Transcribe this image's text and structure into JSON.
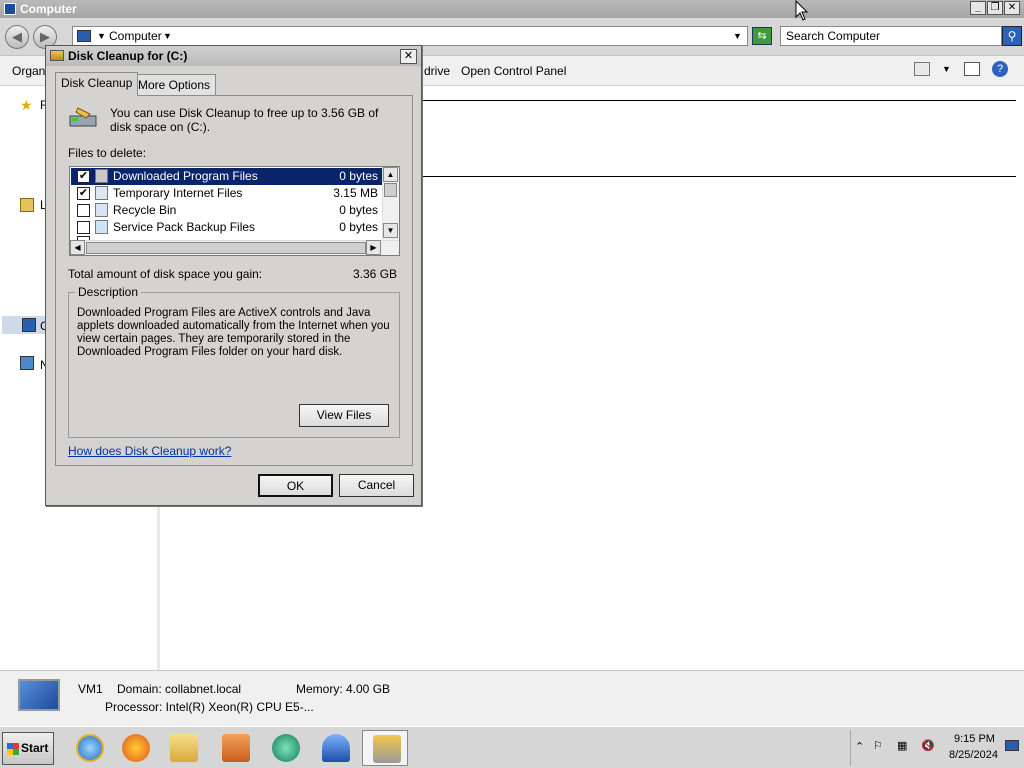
{
  "window": {
    "title": "Computer"
  },
  "address": {
    "crumb": "Computer",
    "search_placeholder": "Search Computer"
  },
  "commandbar": {
    "organize": "Organi",
    "drive": "drive",
    "control_panel": "Open Control Panel"
  },
  "nav_letters": {
    "favorites": "F",
    "libraries": "L",
    "computer": "C",
    "network": "N"
  },
  "details": {
    "name": "VM1",
    "domain": "Domain: collabnet.local",
    "memory": "Memory: 4.00 GB",
    "processor": "Processor: Intel(R) Xeon(R) CPU E5-..."
  },
  "taskbar": {
    "start": "Start",
    "time": "9:15 PM",
    "date": "8/25/2024"
  },
  "dialog": {
    "title": "Disk Cleanup for  (C:)",
    "tabs": [
      "Disk Cleanup",
      "More Options"
    ],
    "intro": "You can use Disk Cleanup to free up to 3.56 GB of disk space on  (C:).",
    "files_label": "Files to delete:",
    "files": [
      {
        "name": "Downloaded Program Files",
        "size": "0 bytes",
        "checked": true,
        "selected": true
      },
      {
        "name": "Temporary Internet Files",
        "size": "3.15 MB",
        "checked": true,
        "selected": false
      },
      {
        "name": "Recycle Bin",
        "size": "0 bytes",
        "checked": false,
        "selected": false
      },
      {
        "name": "Service Pack Backup Files",
        "size": "0 bytes",
        "checked": false,
        "selected": false
      }
    ],
    "total_label": "Total amount of disk space you gain:",
    "total_value": "3.36 GB",
    "description_legend": "Description",
    "description": "Downloaded Program Files are ActiveX controls and Java applets downloaded automatically from the Internet when you view certain pages. They are temporarily stored in the Downloaded Program Files folder on your hard disk.",
    "view_files": "View Files",
    "help_link": "How does Disk Cleanup work?",
    "ok": "OK",
    "cancel": "Cancel"
  }
}
